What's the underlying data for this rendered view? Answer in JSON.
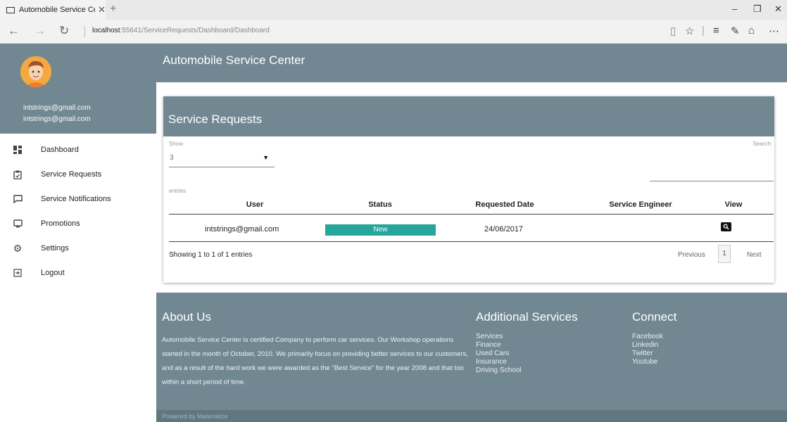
{
  "browser": {
    "tab_title": "Automobile Service Cen",
    "url_host": "localhost",
    "url_path": ":55641/ServiceRequests/Dashboard/Dashboard"
  },
  "sidebar": {
    "user_email": "intstrings@gmail.com",
    "user_name": "intstrings@gmail.com",
    "items": [
      {
        "label": "Dashboard",
        "icon": "dashboard-icon"
      },
      {
        "label": "Service Requests",
        "icon": "clipboard-icon"
      },
      {
        "label": "Service Notifications",
        "icon": "message-icon"
      },
      {
        "label": "Promotions",
        "icon": "tv-icon"
      },
      {
        "label": "Settings",
        "icon": "gear-icon"
      },
      {
        "label": "Logout",
        "icon": "logout-icon"
      }
    ]
  },
  "header": {
    "app_title": "Automobile Service Center"
  },
  "card": {
    "title": "Service Requests",
    "show_label": "Show",
    "show_value": "3",
    "entries_label": "entries",
    "search_label": "Search:",
    "columns": [
      "User",
      "Status",
      "Requested Date",
      "Service Engineer",
      "View"
    ],
    "rows": [
      {
        "user": "intstrings@gmail.com",
        "status": "New",
        "requested_date": "24/06/2017",
        "service_engineer": ""
      }
    ],
    "info": "Showing 1 to 1 of 1 entries",
    "pagination": {
      "previous": "Previous",
      "current": "1",
      "next": "Next"
    }
  },
  "footer": {
    "about_title": "About Us",
    "about_text": "Automobile Service Center is certified Company to perform car services. Our Workshop operations started in the month of October, 2010. We primarily focus on providing better services to our customers, and as a result of the hard work we were awarded as the \"Best Service\" for the year 2008 and that too within a short period of time.",
    "services_title": "Additional Services",
    "services": [
      "Services",
      "Finance",
      "Used Cars",
      "Insurance",
      "Driving School"
    ],
    "connect_title": "Connect",
    "connect": [
      "Facebook",
      "Linkedin",
      "Twitter",
      "Youtube"
    ],
    "bottom": "Powered by Materialize"
  },
  "colors": {
    "primary": "#718892",
    "status_new": "#26a69a",
    "footer_bottom": "#60777f"
  }
}
